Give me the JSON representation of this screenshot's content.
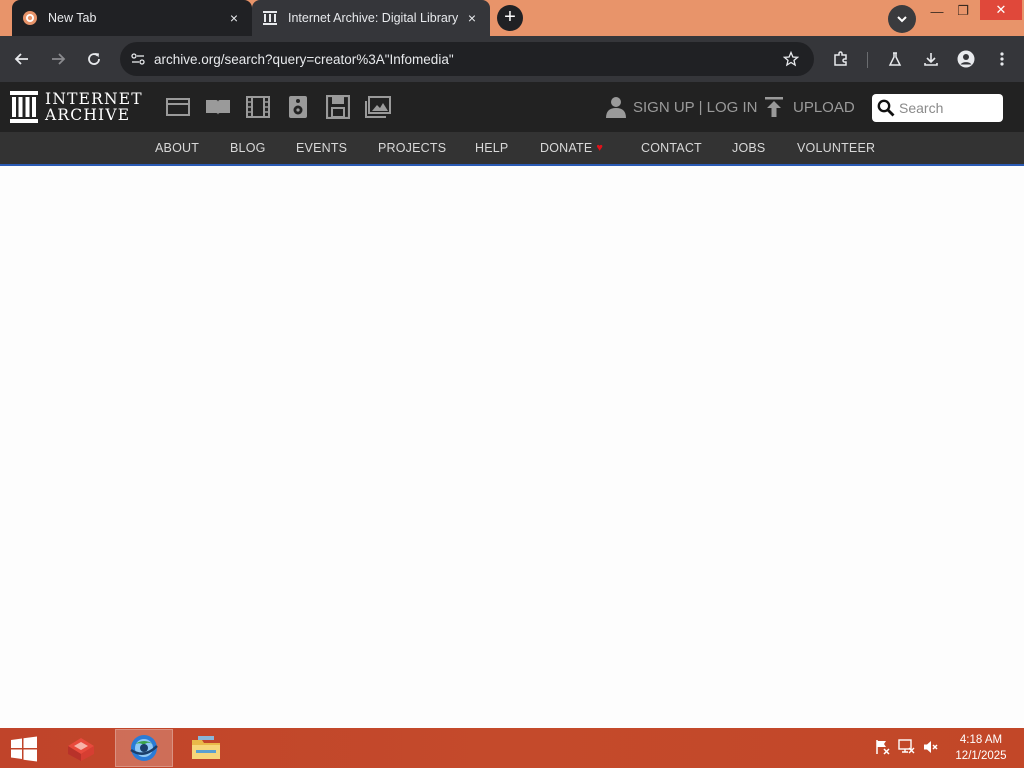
{
  "browser": {
    "tabs": [
      {
        "title": "New Tab",
        "active": false,
        "close_glyph": "×"
      },
      {
        "title": "Internet Archive: Digital Library of Free & Borrowable Texts",
        "active": true,
        "close_glyph": "×"
      }
    ],
    "new_tab_glyph": "+",
    "url": "archive.org/search?query=creator%3A\"Infomedia\"",
    "window_controls": {
      "minimize": "—",
      "maximize": "❐",
      "close": "✕"
    }
  },
  "ia_header": {
    "logo_line1": "INTERNET",
    "logo_line2": "ARCHIVE",
    "media_icons": [
      "web-icon",
      "texts-icon",
      "video-icon",
      "audio-icon",
      "software-icon",
      "images-icon"
    ],
    "signup_label": "SIGN UP | LOG IN",
    "upload_label": "UPLOAD",
    "search_placeholder": "Search"
  },
  "nav_items": [
    "ABOUT",
    "BLOG",
    "EVENTS",
    "PROJECTS",
    "HELP",
    "DONATE",
    "CONTACT",
    "JOBS",
    "VOLUNTEER"
  ],
  "taskbar": {
    "time": "4:18 AM",
    "date": "12/1/2025"
  },
  "colors": {
    "tabstrip": "#e8946a",
    "ia_dark": "#222222",
    "ia_nav": "#333333",
    "donate_heart": "#e0121a",
    "taskbar": "#c0442a"
  }
}
